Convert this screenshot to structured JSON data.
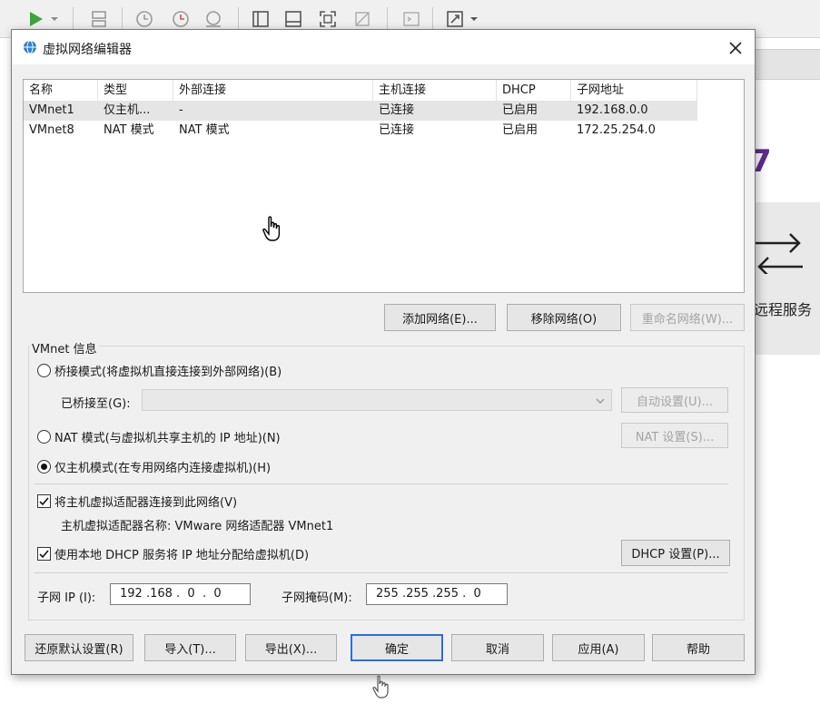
{
  "background_app": {
    "toolbar_icons": [
      "play-icon",
      "dropdown-icon",
      "network-icon",
      "snapshot-icon",
      "revert-snapshot-icon",
      "snapshot-manager-icon",
      "sidebar-icon",
      "console-icon",
      "fullscreen-icon",
      "unity-icon",
      "terminal-icon",
      "stretch-icon"
    ],
    "side_text": "远程服务",
    "big_glyph": "7"
  },
  "dialog": {
    "title": "虚拟网络编辑器",
    "title_icon": "globe-network-icon",
    "close_icon": "close-icon"
  },
  "network_list": {
    "columns": [
      "名称",
      "类型",
      "外部连接",
      "主机连接",
      "DHCP",
      "子网地址"
    ],
    "rows": [
      {
        "name": "VMnet1",
        "type": "仅主机...",
        "external": "-",
        "host": "已连接",
        "dhcp": "已启用",
        "subnet": "192.168.0.0"
      },
      {
        "name": "VMnet8",
        "type": "NAT 模式",
        "external": "NAT 模式",
        "host": "已连接",
        "dhcp": "已启用",
        "subnet": "172.25.254.0"
      }
    ],
    "selected_row": 0
  },
  "list_buttons": {
    "add": "添加网络(E)...",
    "remove": "移除网络(O)",
    "rename": "重命名网络(W)..."
  },
  "vmnet_info": {
    "group_label": "VMnet 信息",
    "bridged_label": "桥接模式(将虚拟机直接连接到外部网络)(B)",
    "bridged_to_label": "已桥接至(G):",
    "bridged_to_value": "",
    "auto_settings": "自动设置(U)...",
    "nat_label": "NAT 模式(与虚拟机共享主机的 IP 地址)(N)",
    "nat_settings": "NAT 设置(S)...",
    "host_only_label": "仅主机模式(在专用网络内连接虚拟机)(H)",
    "selected_mode": "host_only",
    "connect_adapter_label": "将主机虚拟适配器连接到此网络(V)",
    "connect_adapter_checked": true,
    "adapter_name_text": "主机虚拟适配器名称: VMware 网络适配器 VMnet1",
    "use_dhcp_label": "使用本地 DHCP 服务将 IP 地址分配给虚拟机(D)",
    "use_dhcp_checked": true,
    "dhcp_settings": "DHCP 设置(P)...",
    "subnet_ip_label": "子网 IP (I):",
    "subnet_ip_value": "192 .168 .  0  .  0",
    "subnet_mask_label": "子网掩码(M):",
    "subnet_mask_value": "255 .255 .255 .  0"
  },
  "footer_buttons": {
    "restore_defaults": "还原默认设置(R)",
    "import": "导入(T)...",
    "export": "导出(X)...",
    "ok": "确定",
    "cancel": "取消",
    "apply": "应用(A)",
    "help": "帮助"
  },
  "colors": {
    "dialog_bg": "#f0f0f0",
    "accent_default_button": "#2a6fd6",
    "selected_row": "#e5e5e5",
    "play_green": "#3aa53a",
    "purple_glyph": "#5a2d91"
  }
}
